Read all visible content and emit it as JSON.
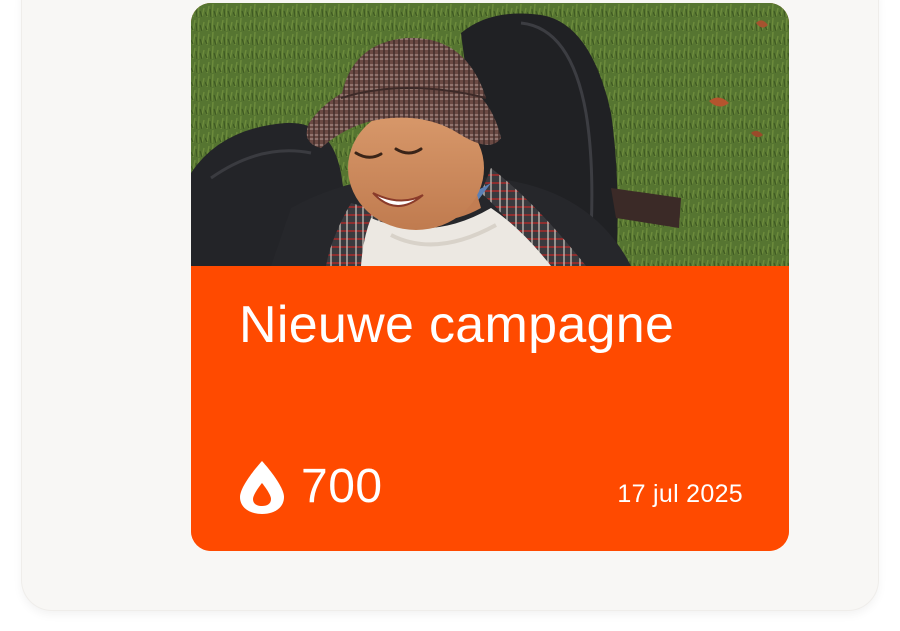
{
  "card": {
    "image_alt": "Smiling woman in a checked bucket hat lying on grass",
    "title": "Nieuwe campagne",
    "points_icon": "drop-icon",
    "points": "700",
    "date": "17 jul 2025"
  },
  "colors": {
    "accent": "#ff4a00",
    "text": "#ffffff",
    "panel": "#f8f7f5"
  }
}
